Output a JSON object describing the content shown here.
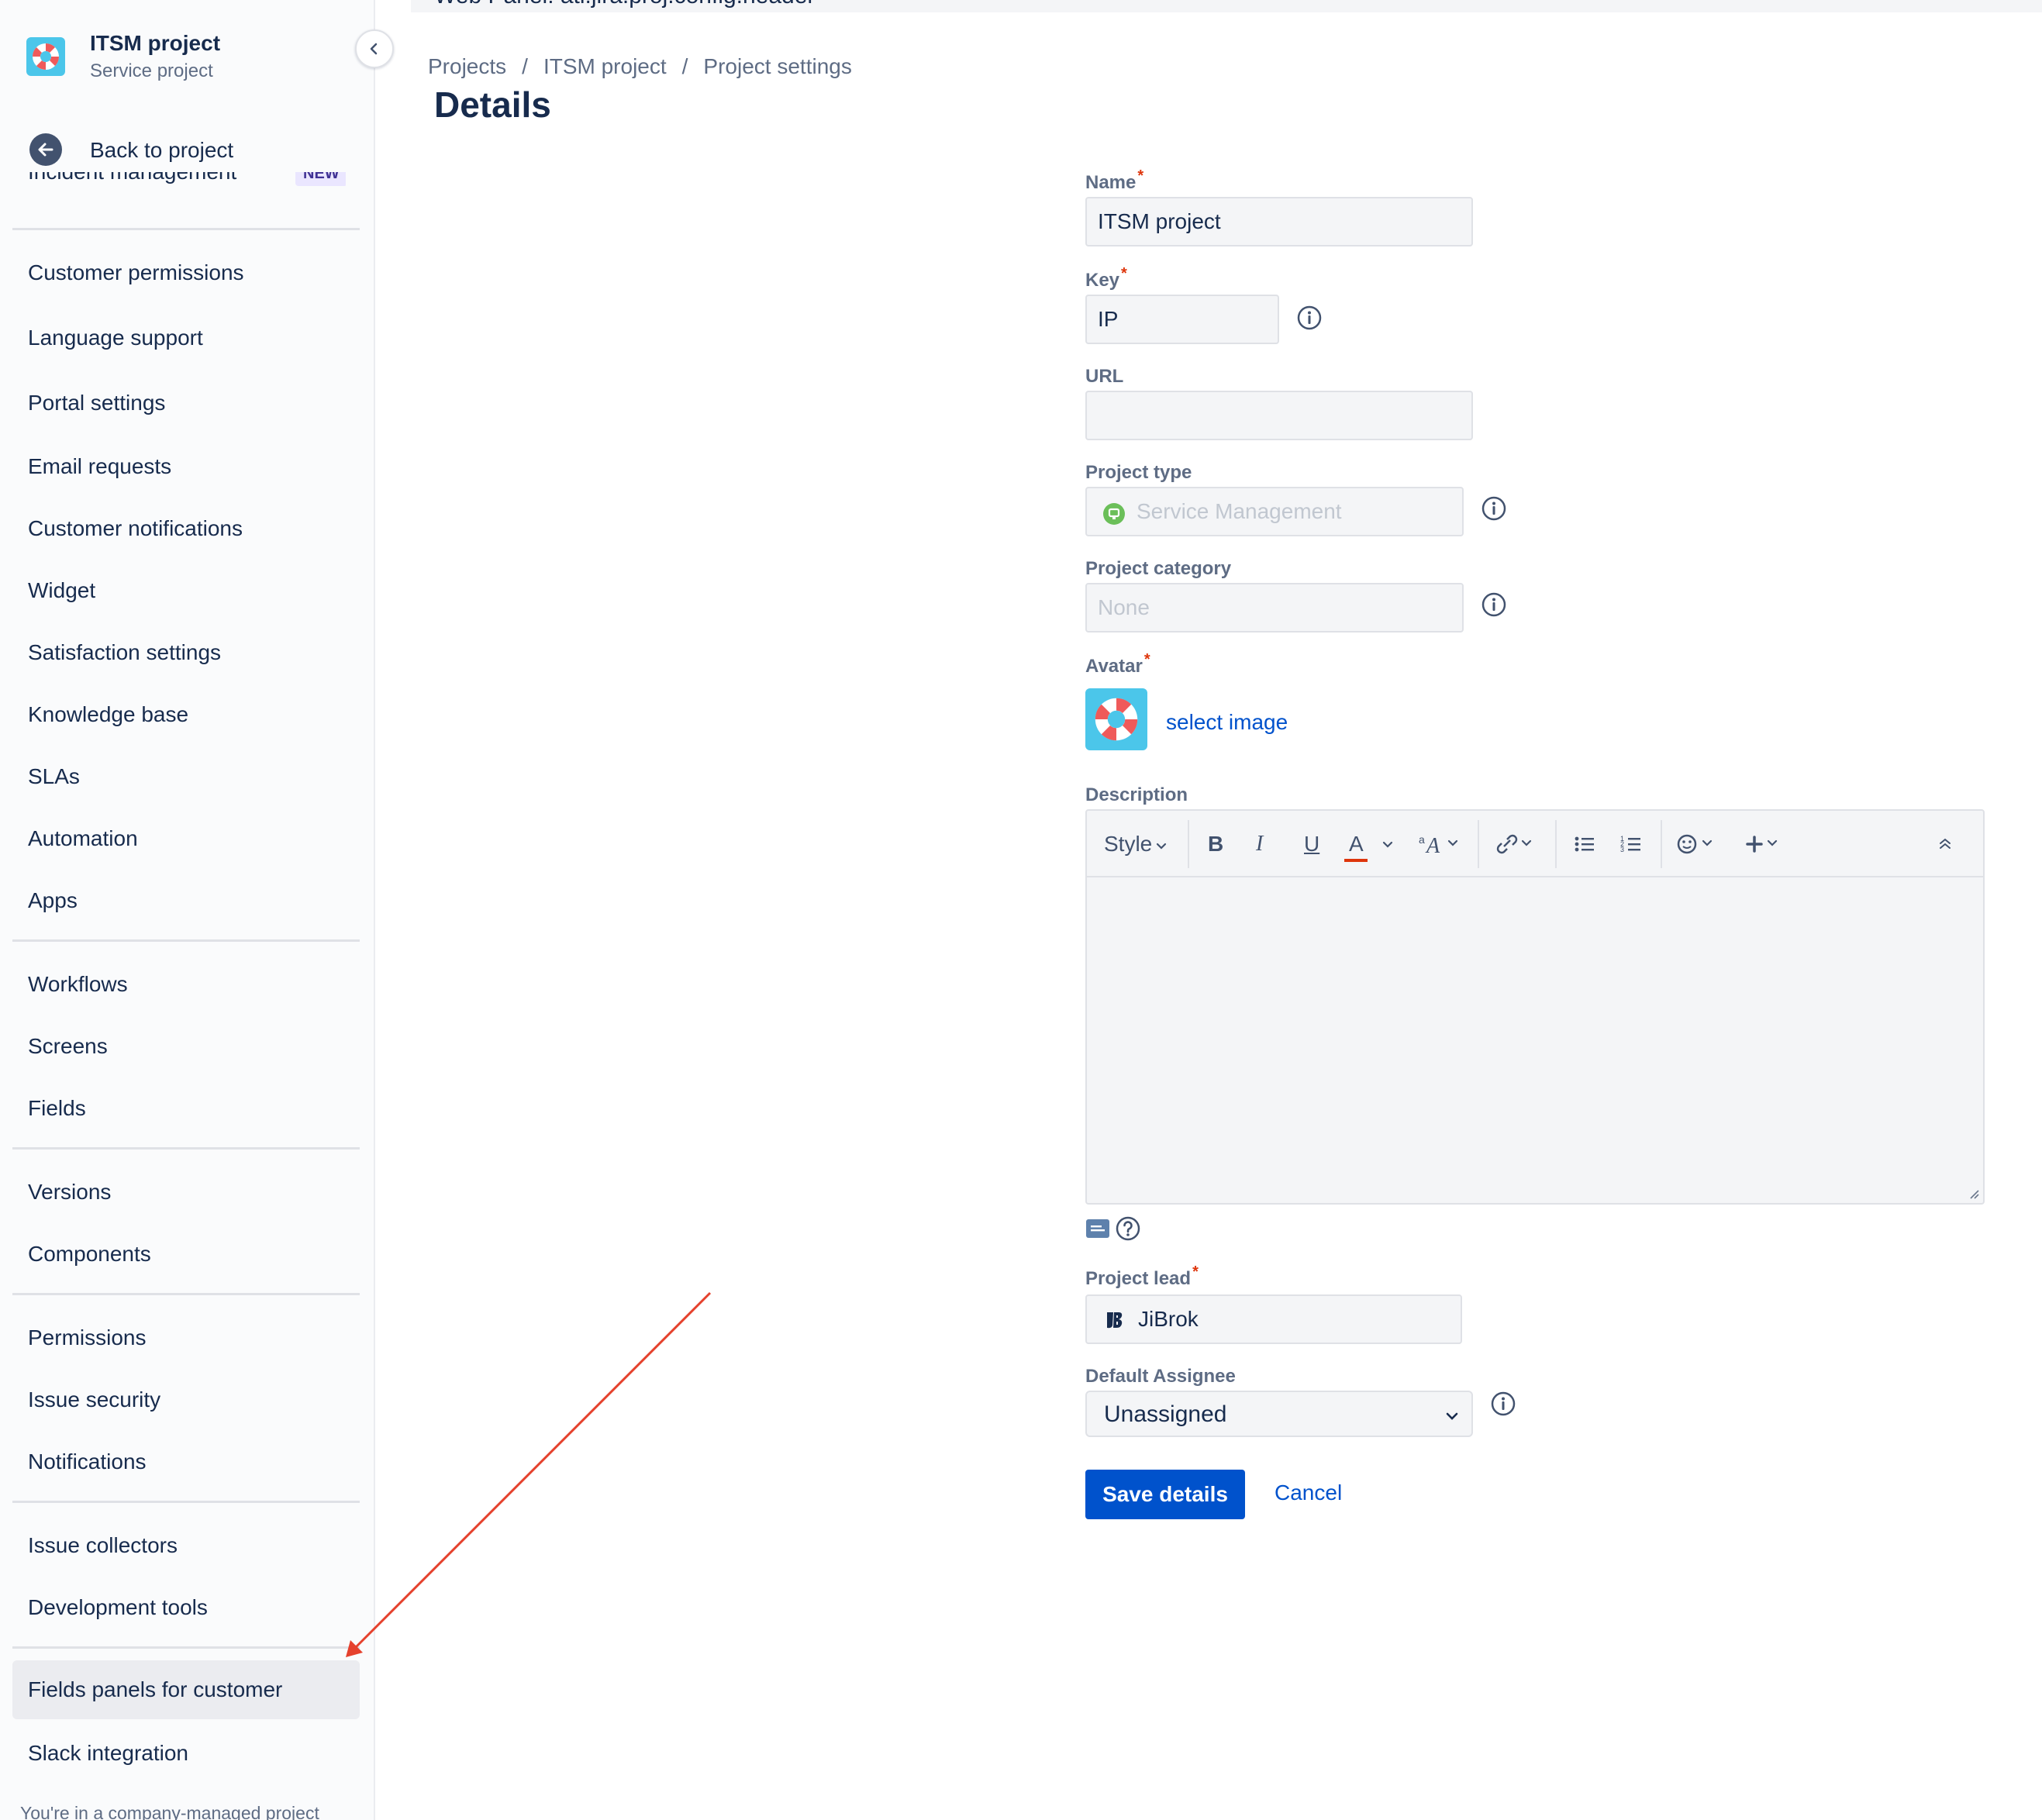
{
  "topbar": {
    "text": "Web Panel: atl.jira.proj.config.header"
  },
  "project": {
    "name": "ITSM project",
    "type": "Service project"
  },
  "sidebar": {
    "collapse_icon": "chevron-left-icon",
    "back_label": "Back to project",
    "cut_item": {
      "label": "Incident management",
      "badge": "NEW"
    },
    "group1": [
      {
        "label": "Customer permissions"
      },
      {
        "label": "Language support"
      },
      {
        "label": "Portal settings"
      },
      {
        "label": "Email requests"
      },
      {
        "label": "Customer notifications"
      },
      {
        "label": "Widget"
      },
      {
        "label": "Satisfaction settings"
      },
      {
        "label": "Knowledge base"
      },
      {
        "label": "SLAs"
      },
      {
        "label": "Automation"
      },
      {
        "label": "Apps"
      }
    ],
    "group2": [
      {
        "label": "Workflows"
      },
      {
        "label": "Screens"
      },
      {
        "label": "Fields"
      }
    ],
    "group3": [
      {
        "label": "Versions"
      },
      {
        "label": "Components"
      }
    ],
    "group4": [
      {
        "label": "Permissions"
      },
      {
        "label": "Issue security"
      },
      {
        "label": "Notifications"
      }
    ],
    "group5": [
      {
        "label": "Issue collectors"
      },
      {
        "label": "Development tools"
      }
    ],
    "group6": [
      {
        "label": "Fields panels for customer",
        "selected": true
      },
      {
        "label": "Slack integration"
      }
    ],
    "footer": "You're in a company-managed project"
  },
  "breadcrumbs": [
    "Projects",
    "ITSM project",
    "Project settings"
  ],
  "breadcrumb_separator": "/",
  "page_title": "Details",
  "form": {
    "name": {
      "label": "Name",
      "value": "ITSM project",
      "required": "*"
    },
    "key": {
      "label": "Key",
      "value": "IP",
      "required": "*"
    },
    "url": {
      "label": "URL",
      "value": ""
    },
    "project_type": {
      "label": "Project type",
      "value": "Service Management"
    },
    "project_category": {
      "label": "Project category",
      "value": "None"
    },
    "avatar": {
      "label": "Avatar",
      "required": "*",
      "select_label": "select image"
    },
    "description": {
      "label": "Description",
      "toolbar": {
        "style": "Style",
        "bold": "B",
        "italic": "I",
        "underline": "U",
        "color": "A"
      },
      "value": ""
    },
    "project_lead": {
      "label": "Project lead",
      "value": "JiBrok",
      "required": "*"
    },
    "default_assignee": {
      "label": "Default Assignee",
      "value": "Unassigned"
    },
    "save_label": "Save details",
    "cancel_label": "Cancel"
  },
  "colors": {
    "primary": "#0052cc",
    "required": "#de350b",
    "annotation_arrow": "#e5412d",
    "text": "#172b4d",
    "muted": "#5e6c84"
  }
}
